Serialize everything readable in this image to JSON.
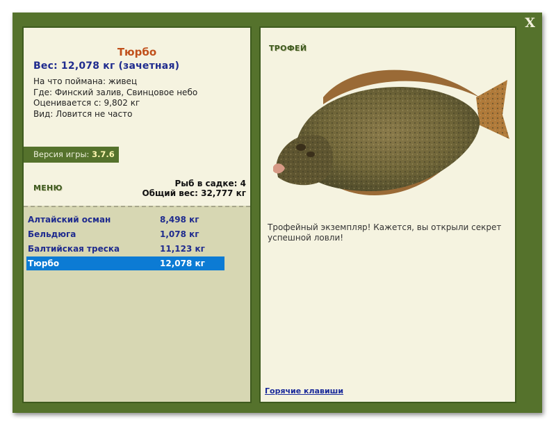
{
  "window": {
    "close_label": "X"
  },
  "fish": {
    "title": "Тюрбо",
    "weight_line": "Вес: 12,078 кг (зачетная)",
    "info": [
      "На что поймана: живец",
      "Где: Финский залив, Свинцовое небо",
      "Оценивается с: 9,802 кг",
      "Вид: Ловится не часто"
    ]
  },
  "version": {
    "label": "Версия игры:",
    "value": "3.7.6"
  },
  "menu": {
    "label": "МЕНЮ"
  },
  "stats": {
    "fish_count": "Рыб в садке: 4",
    "total_weight": "Общий вес: 32,777 кг"
  },
  "catch_list": [
    {
      "name": "Алтайский осман",
      "weight": "8,498 кг",
      "selected": false
    },
    {
      "name": "Бельдюга",
      "weight": "1,078 кг",
      "selected": false
    },
    {
      "name": "Балтийская треска",
      "weight": "11,123 кг",
      "selected": false
    },
    {
      "name": "Тюрбо",
      "weight": "12,078 кг",
      "selected": true
    }
  ],
  "trophy": {
    "label": "ТРОФЕЙ",
    "description": "Трофейный экземпляр! Кажется, вы открыли секрет успешной ловли!",
    "image_icon": "turbot-fish-image"
  },
  "hotkeys": {
    "label": "Горячие клавиши"
  },
  "colors": {
    "frame": "#55722c",
    "panel": "#f5f3e0",
    "list_bg": "#d7d7b3",
    "selected": "#0c7bd4",
    "title": "#c0501b",
    "weight": "#1f2b8e"
  }
}
